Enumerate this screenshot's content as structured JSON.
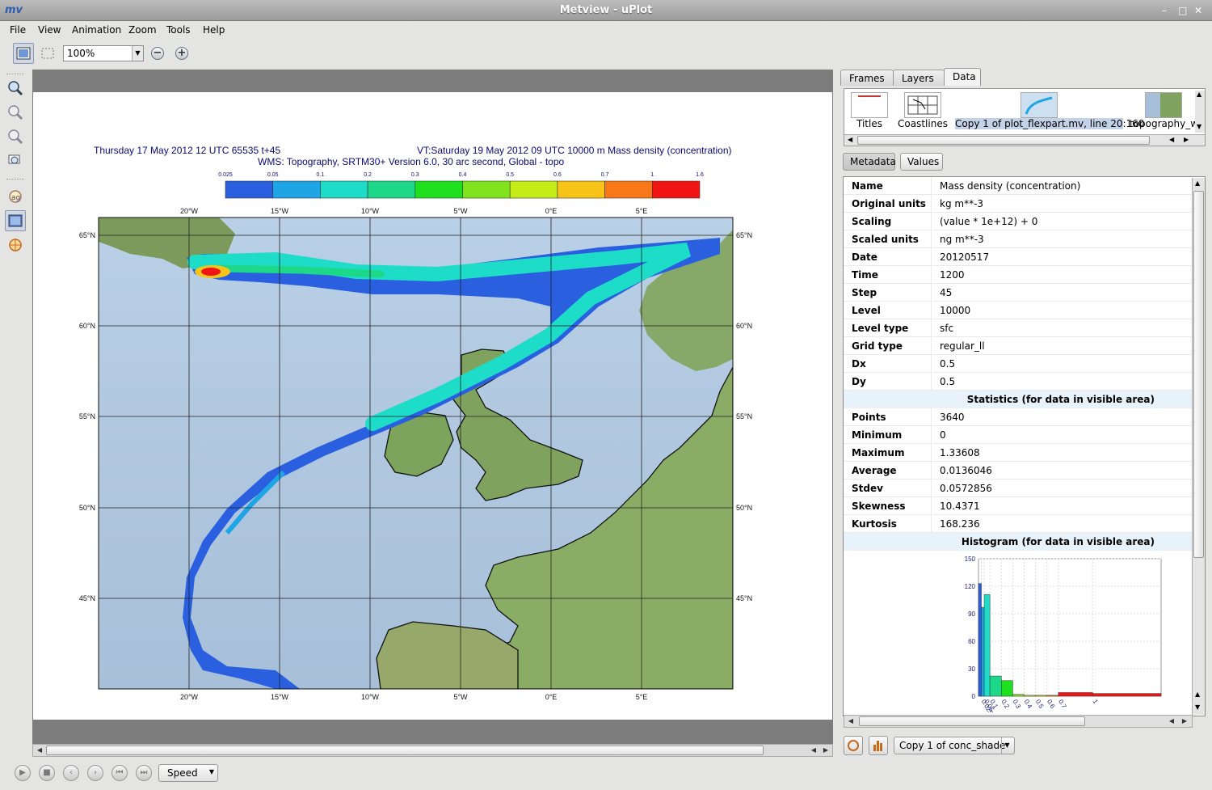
{
  "window": {
    "title": "Metview - uPlot",
    "logo": "mv"
  },
  "menu": [
    "File",
    "View",
    "Animation",
    "Zoom",
    "Tools",
    "Help"
  ],
  "toolbar": {
    "zoom_value": "100%"
  },
  "plot": {
    "title_left": "Thursday 17 May 2012 12 UTC 65535 t+45",
    "title_right": "VT:Saturday 19 May 2012 09 UTC 10000 m  Mass density (concentration)",
    "subtitle": "WMS: Topography, SRTM30+ Version 6.0, 30 arc second, Global - topo",
    "legend_values": [
      "0.025",
      "0.05",
      "0.1",
      "0.2",
      "0.3",
      "0.4",
      "0.5",
      "0.6",
      "0.7",
      "1",
      "1.6"
    ],
    "legend_colors": [
      "#2a60e0",
      "#1fa4e6",
      "#1ddcc8",
      "#1ed88a",
      "#1ee01e",
      "#80e41c",
      "#c6ec18",
      "#f8c418",
      "#f87818",
      "#f01414"
    ],
    "lon_labels": [
      "20°W",
      "15°W",
      "10°W",
      "5°W",
      "0°E",
      "5°E"
    ],
    "lat_labels": [
      "65°N",
      "60°N",
      "55°N",
      "50°N",
      "45°N"
    ]
  },
  "animation": {
    "speed_label": "Speed"
  },
  "right_panel": {
    "tabs": [
      "Frames",
      "Layers",
      "Data"
    ],
    "layers": [
      {
        "label": "Titles"
      },
      {
        "label": "Coastlines"
      },
      {
        "label": "Copy 1 of plot_flexpart.mv, line 20:160"
      },
      {
        "label": "topography_w"
      }
    ],
    "buttons": {
      "metadata": "Metadata",
      "values": "Values"
    },
    "metadata": [
      {
        "key": "Name",
        "value": "Mass density (concentration)"
      },
      {
        "key": "Original units",
        "value": "kg m**-3"
      },
      {
        "key": "Scaling",
        "value": "(value * 1e+12) + 0"
      },
      {
        "key": "Scaled units",
        "value": "ng m**-3"
      },
      {
        "key": "Date",
        "value": "20120517"
      },
      {
        "key": "Time",
        "value": "1200"
      },
      {
        "key": "Step",
        "value": "45"
      },
      {
        "key": "Level",
        "value": "10000"
      },
      {
        "key": "Level type",
        "value": "sfc"
      },
      {
        "key": "Grid type",
        "value": "regular_ll"
      },
      {
        "key": "Dx",
        "value": "0.5"
      },
      {
        "key": "Dy",
        "value": "0.5"
      }
    ],
    "stats_header": "Statistics (for data in visible area)",
    "stats": [
      {
        "key": "Points",
        "value": "3640"
      },
      {
        "key": "Minimum",
        "value": "0"
      },
      {
        "key": "Maximum",
        "value": "1.33608"
      },
      {
        "key": "Average",
        "value": "0.0136046"
      },
      {
        "key": "Stdev",
        "value": "0.0572856"
      },
      {
        "key": "Skewness",
        "value": "10.4371"
      },
      {
        "key": "Kurtosis",
        "value": "168.236"
      }
    ],
    "histogram_header": "Histogram (for data in visible area)",
    "layer_select": "Copy 1 of conc_shade"
  },
  "chart_data": {
    "type": "bar",
    "yticks": [
      0,
      30,
      60,
      90,
      120,
      150
    ],
    "ylim": [
      0,
      150
    ],
    "xtick_labels": [
      "0.025",
      "0.05",
      "0.1",
      "0.2",
      "0.3",
      "0.4",
      "0.5",
      "0.6",
      "0.7",
      "1"
    ],
    "edges": [
      0,
      0.025,
      0.05,
      0.1,
      0.2,
      0.3,
      0.4,
      0.5,
      0.6,
      0.7,
      1,
      1.6
    ],
    "values": [
      123,
      97,
      111,
      22,
      17,
      2,
      1,
      1,
      1,
      4,
      3
    ],
    "colors": [
      "#2a60e0",
      "#1fa4e6",
      "#1ddcc8",
      "#1ed88a",
      "#1ee01e",
      "#80e41c",
      "#c6ec18",
      "#f8c418",
      "#f87818",
      "#f01414",
      "#f01414"
    ]
  }
}
